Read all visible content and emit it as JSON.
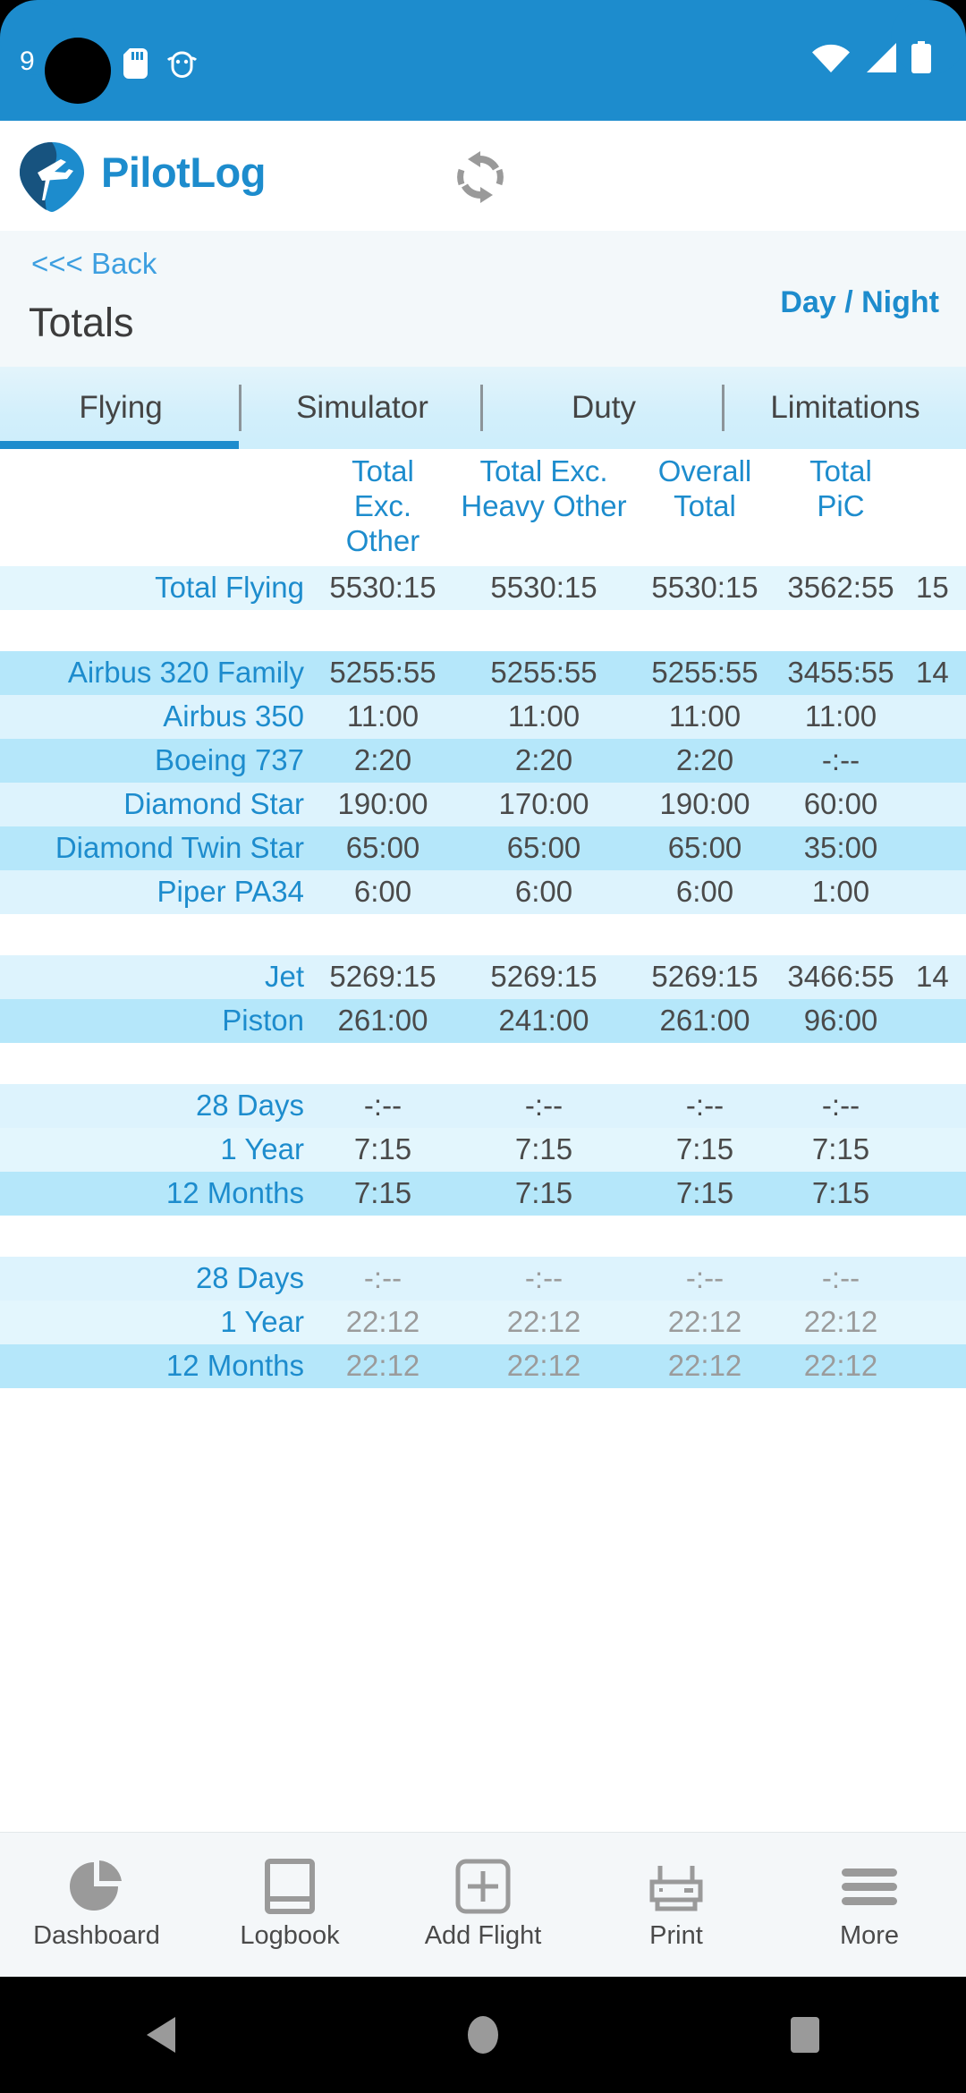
{
  "status_bar": {
    "time": "9",
    "icons": [
      "sd-card-icon",
      "android-debug-icon",
      "wifi-icon",
      "cellular-signal-icon",
      "battery-icon"
    ]
  },
  "app_header": {
    "brand": "PilotLog",
    "logo": "pilotlog-pin-logo",
    "refresh": "refresh-sync-icon"
  },
  "sub_header": {
    "back_label": "<<< Back",
    "title": "Totals",
    "day_night_label": "Day / Night"
  },
  "tabs": [
    {
      "label": "Flying",
      "active": true
    },
    {
      "label": "Simulator",
      "active": false
    },
    {
      "label": "Duty",
      "active": false
    },
    {
      "label": "Limitations",
      "active": false
    }
  ],
  "table": {
    "columns": [
      {
        "line1": "",
        "line2": ""
      },
      {
        "line1": "Total",
        "line2": "Exc. Other"
      },
      {
        "line1": "Total Exc.",
        "line2": "Heavy Other"
      },
      {
        "line1": "Overall",
        "line2": "Total"
      },
      {
        "line1": "Total",
        "line2": "PiC"
      },
      {
        "line1": "",
        "line2": ""
      }
    ],
    "groups": [
      {
        "rows": [
          {
            "label": "Total Flying",
            "values": [
              "5530:15",
              "5530:15",
              "5530:15",
              "3562:55",
              "15"
            ],
            "dim": false
          }
        ]
      },
      {
        "rows": [
          {
            "label": "Airbus 320 Family",
            "values": [
              "5255:55",
              "5255:55",
              "5255:55",
              "3455:55",
              "14"
            ],
            "dim": false
          },
          {
            "label": "Airbus 350",
            "values": [
              "11:00",
              "11:00",
              "11:00",
              "11:00",
              ""
            ],
            "dim": false
          },
          {
            "label": "Boeing 737",
            "values": [
              "2:20",
              "2:20",
              "2:20",
              "-:--",
              ""
            ],
            "dim": false
          },
          {
            "label": "Diamond Star",
            "values": [
              "190:00",
              "170:00",
              "190:00",
              "60:00",
              ""
            ],
            "dim": false
          },
          {
            "label": "Diamond Twin Star",
            "values": [
              "65:00",
              "65:00",
              "65:00",
              "35:00",
              ""
            ],
            "dim": false
          },
          {
            "label": "Piper PA34",
            "values": [
              "6:00",
              "6:00",
              "6:00",
              "1:00",
              ""
            ],
            "dim": false
          }
        ]
      },
      {
        "rows": [
          {
            "label": "Jet",
            "values": [
              "5269:15",
              "5269:15",
              "5269:15",
              "3466:55",
              "14"
            ],
            "dim": false
          },
          {
            "label": "Piston",
            "values": [
              "261:00",
              "241:00",
              "261:00",
              "96:00",
              ""
            ],
            "dim": false
          }
        ]
      },
      {
        "rows": [
          {
            "label": "28 Days",
            "values": [
              "-:--",
              "-:--",
              "-:--",
              "-:--",
              ""
            ],
            "dim": false
          },
          {
            "label": "1 Year",
            "values": [
              "7:15",
              "7:15",
              "7:15",
              "7:15",
              ""
            ],
            "dim": false
          },
          {
            "label": "12 Months",
            "values": [
              "7:15",
              "7:15",
              "7:15",
              "7:15",
              ""
            ],
            "dim": false
          }
        ]
      },
      {
        "rows": [
          {
            "label": "28 Days",
            "values": [
              "-:--",
              "-:--",
              "-:--",
              "-:--",
              ""
            ],
            "dim": true
          },
          {
            "label": "1 Year",
            "values": [
              "22:12",
              "22:12",
              "22:12",
              "22:12",
              ""
            ],
            "dim": true
          },
          {
            "label": "12 Months",
            "values": [
              "22:12",
              "22:12",
              "22:12",
              "22:12",
              ""
            ],
            "dim": true
          }
        ]
      }
    ]
  },
  "bottom_nav": [
    {
      "label": "Dashboard",
      "icon": "pie-chart-icon"
    },
    {
      "label": "Logbook",
      "icon": "book-icon"
    },
    {
      "label": "Add Flight",
      "icon": "plus-square-icon"
    },
    {
      "label": "Print",
      "icon": "printer-icon"
    },
    {
      "label": "More",
      "icon": "hamburger-menu-icon"
    }
  ],
  "system_nav": [
    {
      "name": "back",
      "icon": "triangle-back-icon"
    },
    {
      "name": "home",
      "icon": "circle-home-icon"
    },
    {
      "name": "recents",
      "icon": "square-recents-icon"
    }
  ],
  "colors": {
    "brand_blue": "#1d8ccd",
    "row_light": "#e3f6fd",
    "row_mid": "#b5e7fa",
    "row_pale": "#ddf3fd",
    "dim_text": "#9b9b9b"
  }
}
